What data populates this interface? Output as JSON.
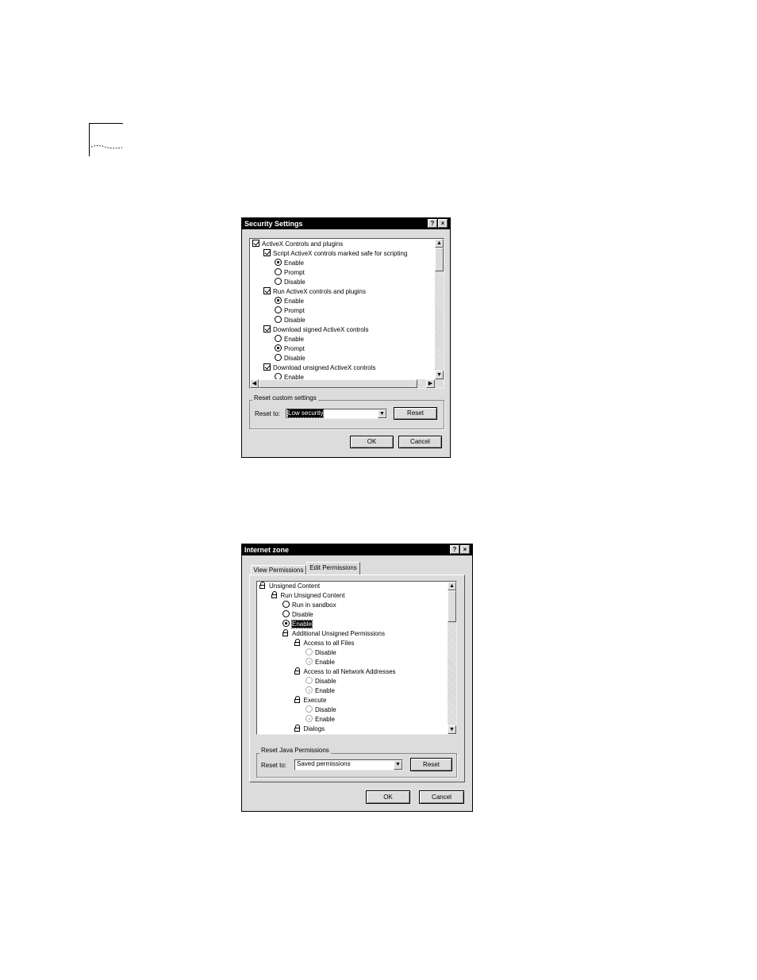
{
  "security_dialog": {
    "title": "Security Settings",
    "help_glyph": "?",
    "close_glyph": "×",
    "tree": [
      {
        "type": "checkbox",
        "level": 0,
        "label": "ActiveX Controls and plugins"
      },
      {
        "type": "checkbox",
        "level": 1,
        "label": "Script ActiveX controls marked safe for scripting"
      },
      {
        "type": "radio",
        "level": 2,
        "label": "Enable",
        "selected": true
      },
      {
        "type": "radio",
        "level": 2,
        "label": "Prompt",
        "selected": false
      },
      {
        "type": "radio",
        "level": 2,
        "label": "Disable",
        "selected": false
      },
      {
        "type": "checkbox",
        "level": 1,
        "label": "Run ActiveX controls and plugins"
      },
      {
        "type": "radio",
        "level": 2,
        "label": "Enable",
        "selected": true
      },
      {
        "type": "radio",
        "level": 2,
        "label": "Prompt",
        "selected": false
      },
      {
        "type": "radio",
        "level": 2,
        "label": "Disable",
        "selected": false
      },
      {
        "type": "checkbox",
        "level": 1,
        "label": "Download signed ActiveX controls"
      },
      {
        "type": "radio",
        "level": 2,
        "label": "Enable",
        "selected": false
      },
      {
        "type": "radio",
        "level": 2,
        "label": "Prompt",
        "selected": true
      },
      {
        "type": "radio",
        "level": 2,
        "label": "Disable",
        "selected": false
      },
      {
        "type": "checkbox",
        "level": 1,
        "label": "Download unsigned ActiveX controls"
      },
      {
        "type": "radio",
        "level": 2,
        "label": "Enable",
        "selected": false
      }
    ],
    "reset_group_label": "Reset custom settings",
    "reset_to_label": "Reset to:",
    "reset_to_value": "Low security",
    "reset_button": "Reset",
    "ok_button": "OK",
    "cancel_button": "Cancel"
  },
  "internet_dialog": {
    "title": "Internet zone",
    "help_glyph": "?",
    "close_glyph": "×",
    "tabs": [
      {
        "label": "View Permissions",
        "active": false
      },
      {
        "label": "Edit Permissions",
        "active": true
      }
    ],
    "tree": [
      {
        "type": "lock",
        "level": 0,
        "label": "Unsigned Content"
      },
      {
        "type": "lock",
        "level": 1,
        "label": "Run Unsigned Content"
      },
      {
        "type": "radio",
        "level": 2,
        "label": "Run in sandbox",
        "selected": false
      },
      {
        "type": "radio",
        "level": 2,
        "label": "Disable",
        "selected": false
      },
      {
        "type": "radio",
        "level": 2,
        "label": "Enable",
        "selected": true,
        "highlight": true
      },
      {
        "type": "lock",
        "level": 2,
        "label": "Additional Unsigned Permissions"
      },
      {
        "type": "lock",
        "level": 3,
        "label": "Access to all Files"
      },
      {
        "type": "radio",
        "level": 4,
        "label": "Disable",
        "selected": false,
        "dim": true
      },
      {
        "type": "radio",
        "level": 4,
        "label": "Enable",
        "selected": true,
        "dim": true
      },
      {
        "type": "lock",
        "level": 3,
        "label": "Access to all Network Addresses"
      },
      {
        "type": "radio",
        "level": 4,
        "label": "Disable",
        "selected": false,
        "dim": true
      },
      {
        "type": "radio",
        "level": 4,
        "label": "Enable",
        "selected": true,
        "dim": true
      },
      {
        "type": "lock",
        "level": 3,
        "label": "Execute"
      },
      {
        "type": "radio",
        "level": 4,
        "label": "Disable",
        "selected": false,
        "dim": true
      },
      {
        "type": "radio",
        "level": 4,
        "label": "Enable",
        "selected": true,
        "dim": true
      },
      {
        "type": "lock",
        "level": 3,
        "label": "Dialogs"
      }
    ],
    "reset_group_label": "Reset Java Permissions",
    "reset_to_label": "Reset to:",
    "reset_to_value": "Saved permissions",
    "reset_button": "Reset",
    "ok_button": "OK",
    "cancel_button": "Cancel"
  }
}
